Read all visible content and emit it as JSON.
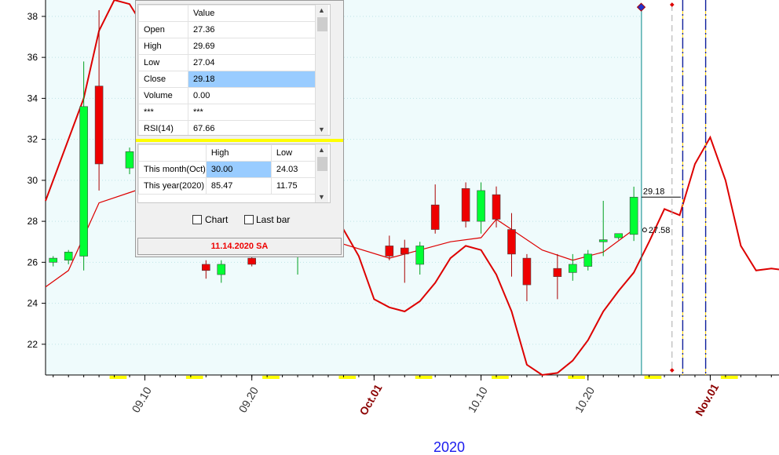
{
  "chart_data": {
    "type": "candlestick",
    "year_label": "2020",
    "x_tick_labels": [
      {
        "label": "09.10",
        "idx": 6,
        "highlight": false
      },
      {
        "label": "09.20",
        "idx": 13,
        "highlight": false
      },
      {
        "label": "Oct.01",
        "idx": 21,
        "highlight": true
      },
      {
        "label": "10.10",
        "idx": 28,
        "highlight": false
      },
      {
        "label": "10.20",
        "idx": 35,
        "highlight": false
      },
      {
        "label": "Nov.01",
        "idx": 43,
        "highlight": true
      }
    ],
    "y_ticks": [
      22,
      24,
      26,
      28,
      30,
      32,
      34,
      36,
      38
    ],
    "ylim": [
      20.5,
      38.8
    ],
    "xlim": [
      -0.5,
      47.5
    ],
    "candles": [
      {
        "i": 0,
        "o": 26.0,
        "h": 26.3,
        "l": 25.8,
        "c": 26.2
      },
      {
        "i": 1,
        "o": 26.1,
        "h": 26.6,
        "l": 25.9,
        "c": 26.5
      },
      {
        "i": 2,
        "o": 26.3,
        "h": 35.8,
        "l": 25.6,
        "c": 33.6
      },
      {
        "i": 3,
        "o": 34.6,
        "h": 38.3,
        "l": 29.5,
        "c": 30.8
      },
      {
        "i": 5,
        "o": 30.6,
        "h": 31.6,
        "l": 30.3,
        "c": 31.4
      },
      {
        "i": 6,
        "o": 31.7,
        "h": 31.9,
        "l": 28.2,
        "c": 28.8
      },
      {
        "i": 10,
        "o": 25.9,
        "h": 26.1,
        "l": 25.2,
        "c": 25.6
      },
      {
        "i": 11,
        "o": 25.4,
        "h": 26.1,
        "l": 25.0,
        "c": 25.9
      },
      {
        "i": 13,
        "o": 26.2,
        "h": 26.4,
        "l": 25.8,
        "c": 25.9
      },
      {
        "i": 16,
        "o": 26.5,
        "h": 26.9,
        "l": 25.4,
        "c": 26.5
      },
      {
        "i": 22,
        "o": 26.8,
        "h": 27.3,
        "l": 26.1,
        "c": 26.3
      },
      {
        "i": 23,
        "o": 26.7,
        "h": 27.1,
        "l": 25.0,
        "c": 26.4
      },
      {
        "i": 24,
        "o": 25.9,
        "h": 27.0,
        "l": 25.4,
        "c": 26.8
      },
      {
        "i": 25,
        "o": 28.8,
        "h": 29.8,
        "l": 27.4,
        "c": 27.6
      },
      {
        "i": 27,
        "o": 29.6,
        "h": 29.9,
        "l": 27.7,
        "c": 28.0
      },
      {
        "i": 28,
        "o": 28.0,
        "h": 29.9,
        "l": 27.4,
        "c": 29.5
      },
      {
        "i": 29,
        "o": 29.3,
        "h": 29.7,
        "l": 27.7,
        "c": 28.1
      },
      {
        "i": 30,
        "o": 27.6,
        "h": 28.4,
        "l": 25.3,
        "c": 26.4
      },
      {
        "i": 31,
        "o": 26.2,
        "h": 26.4,
        "l": 24.1,
        "c": 24.9
      },
      {
        "i": 33,
        "o": 25.7,
        "h": 26.4,
        "l": 24.2,
        "c": 25.3
      },
      {
        "i": 34,
        "o": 25.5,
        "h": 26.4,
        "l": 25.1,
        "c": 25.9
      },
      {
        "i": 35,
        "o": 25.8,
        "h": 26.6,
        "l": 25.6,
        "c": 26.4
      },
      {
        "i": 36,
        "o": 27.0,
        "h": 29.0,
        "l": 26.3,
        "c": 27.1
      },
      {
        "i": 37,
        "o": 27.2,
        "h": 27.4,
        "l": 27.1,
        "c": 27.4
      },
      {
        "i": 38,
        "o": 27.36,
        "h": 29.69,
        "l": 27.04,
        "c": 29.18
      }
    ],
    "ma_line": [
      {
        "x": -0.5,
        "y": 24.8
      },
      {
        "x": 1,
        "y": 25.6
      },
      {
        "x": 3,
        "y": 28.9
      },
      {
        "x": 5,
        "y": 29.4
      },
      {
        "x": 7,
        "y": 29.9
      },
      {
        "x": 8,
        "y": 29.4
      },
      {
        "x": 22,
        "y": 26.2
      },
      {
        "x": 24,
        "y": 26.6
      },
      {
        "x": 26,
        "y": 27.0
      },
      {
        "x": 28,
        "y": 27.2
      },
      {
        "x": 29,
        "y": 28.1
      },
      {
        "x": 30,
        "y": 27.6
      },
      {
        "x": 32,
        "y": 26.6
      },
      {
        "x": 34,
        "y": 26.1
      },
      {
        "x": 36,
        "y": 26.5
      },
      {
        "x": 38,
        "y": 27.6
      }
    ],
    "osc_line": [
      {
        "x": -0.5,
        "y": 29.0
      },
      {
        "x": 2,
        "y": 34.0
      },
      {
        "x": 3,
        "y": 37.3
      },
      {
        "x": 4,
        "y": 38.8
      },
      {
        "x": 5,
        "y": 38.6
      },
      {
        "x": 6,
        "y": 37.4
      },
      {
        "x": 7,
        "y": 34.5
      },
      {
        "x": 8,
        "y": 30.0
      },
      {
        "x": 19,
        "y": 27.6
      },
      {
        "x": 20,
        "y": 26.3
      },
      {
        "x": 21,
        "y": 24.2
      },
      {
        "x": 22,
        "y": 23.8
      },
      {
        "x": 23,
        "y": 23.6
      },
      {
        "x": 24,
        "y": 24.1
      },
      {
        "x": 25,
        "y": 25.0
      },
      {
        "x": 26,
        "y": 26.2
      },
      {
        "x": 27,
        "y": 26.8
      },
      {
        "x": 28,
        "y": 26.6
      },
      {
        "x": 29,
        "y": 25.4
      },
      {
        "x": 30,
        "y": 23.6
      },
      {
        "x": 31,
        "y": 21.0
      },
      {
        "x": 32,
        "y": 20.5
      },
      {
        "x": 33,
        "y": 20.6
      },
      {
        "x": 34,
        "y": 21.2
      },
      {
        "x": 35,
        "y": 22.2
      },
      {
        "x": 36,
        "y": 23.6
      },
      {
        "x": 37,
        "y": 24.6
      },
      {
        "x": 38,
        "y": 25.5
      },
      {
        "x": 39,
        "y": 27.0
      },
      {
        "x": 40,
        "y": 28.6
      },
      {
        "x": 41,
        "y": 28.3
      },
      {
        "x": 42,
        "y": 30.8
      },
      {
        "x": 43,
        "y": 32.1
      },
      {
        "x": 44,
        "y": 30.0
      },
      {
        "x": 45,
        "y": 26.8
      },
      {
        "x": 46,
        "y": 25.6
      },
      {
        "x": 47,
        "y": 25.7
      },
      {
        "x": 48,
        "y": 25.6
      },
      {
        "x": 49,
        "y": 26.0
      },
      {
        "x": 50,
        "y": 26.2
      },
      {
        "x": 51,
        "y": 24.4
      },
      {
        "x": 52,
        "y": 23.3
      },
      {
        "x": 53,
        "y": 21.8
      },
      {
        "x": 54,
        "y": 21.5
      },
      {
        "x": 55,
        "y": 22.7
      },
      {
        "x": 56,
        "y": 25.8
      },
      {
        "x": 57,
        "y": 25.9
      }
    ],
    "cursor": {
      "x": 38.5,
      "close_label": "29.18",
      "open_label": "27.58",
      "close_value": 29.18,
      "open_value": 27.58
    },
    "future_markers": [
      {
        "x": 40.5,
        "style": "dashed-gray"
      },
      {
        "x": 41.2,
        "style": "dash-dot-blue"
      },
      {
        "x": 42.7,
        "style": "dash-dot-blue"
      }
    ],
    "weekend_blocks": [
      4,
      4.5,
      9,
      9.5,
      14,
      14.5,
      19,
      19.5,
      24,
      24.5,
      29,
      29.5,
      34,
      34.5,
      39,
      39.5,
      44,
      44.5,
      49,
      49.5,
      54,
      54.5
    ],
    "colors": {
      "up": "#00ff33",
      "down": "#ee0000",
      "line": "#dd0000",
      "background": "#effbfc",
      "cursor": "#008888"
    }
  },
  "info_panel": {
    "quote_header": "Value",
    "quote_rows": [
      {
        "label": "Open",
        "value": "27.36"
      },
      {
        "label": "High",
        "value": "29.69"
      },
      {
        "label": "Low",
        "value": "27.04"
      },
      {
        "label": "Close",
        "value": "29.18"
      },
      {
        "label": "Volume",
        "value": "0.00"
      },
      {
        "label": "***",
        "value": "***"
      },
      {
        "label": "RSI(14)",
        "value": "67.66"
      }
    ],
    "range_headers": [
      "High",
      "Low"
    ],
    "range_rows": [
      {
        "label": "This month(Oct)",
        "high": "30.00",
        "low": "24.03"
      },
      {
        "label": "This year(2020)",
        "high": "85.47",
        "low": "11.75"
      }
    ],
    "chart_checkbox_label": "Chart",
    "lastbar_checkbox_label": "Last bar",
    "status_text": "11.14.2020 SA"
  }
}
